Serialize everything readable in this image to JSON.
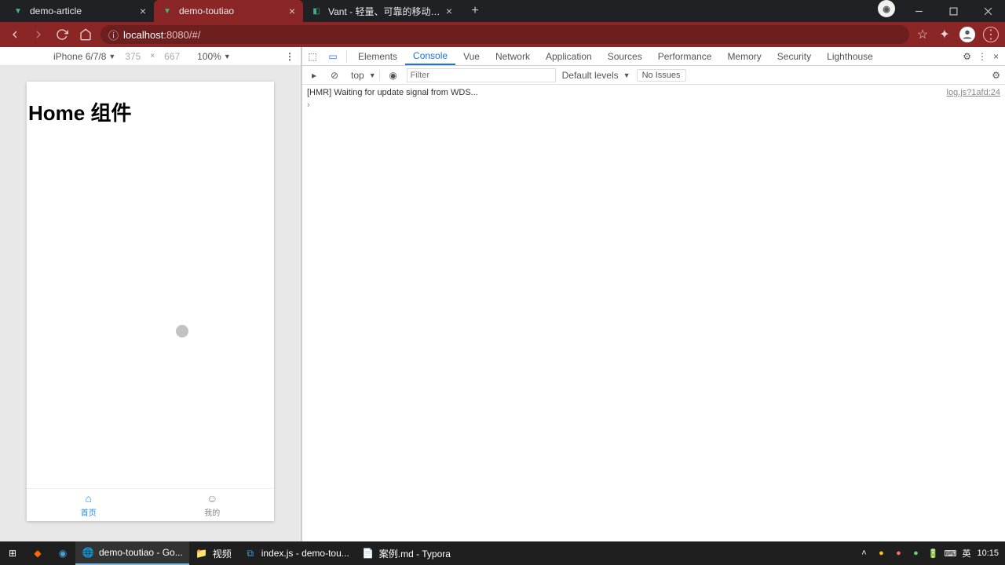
{
  "tabs": [
    {
      "title": "demo-article",
      "active": false
    },
    {
      "title": "demo-toutiao",
      "active": true
    },
    {
      "title": "Vant - 轻量、可靠的移动端组件",
      "active": false
    }
  ],
  "url": {
    "host": "localhost",
    "port": ":8080",
    "path": "/#/"
  },
  "device_toolbar": {
    "device": "iPhone 6/7/8",
    "width": "375",
    "height": "667",
    "zoom": "100%"
  },
  "app": {
    "title": "Home 组件",
    "tabbar": [
      {
        "label": "首页",
        "active": true
      },
      {
        "label": "我的",
        "active": false
      }
    ]
  },
  "devtools": {
    "tabs": [
      "Elements",
      "Console",
      "Vue",
      "Network",
      "Application",
      "Sources",
      "Performance",
      "Memory",
      "Security",
      "Lighthouse"
    ],
    "active_tab": "Console",
    "console_toolbar": {
      "context": "top",
      "filter_placeholder": "Filter",
      "levels": "Default levels",
      "issues": "No Issues"
    },
    "logs": [
      {
        "msg": "[HMR] Waiting for update signal from WDS...",
        "src": "log.js?1afd:24"
      }
    ]
  },
  "taskbar": {
    "items": [
      {
        "label": "demo-toutiao - Go...",
        "active": true
      },
      {
        "label": "视频",
        "active": false
      },
      {
        "label": "index.js - demo-tou...",
        "active": false
      },
      {
        "label": "案例.md - Typora",
        "active": false
      }
    ],
    "ime": "英",
    "time": "10:15"
  }
}
